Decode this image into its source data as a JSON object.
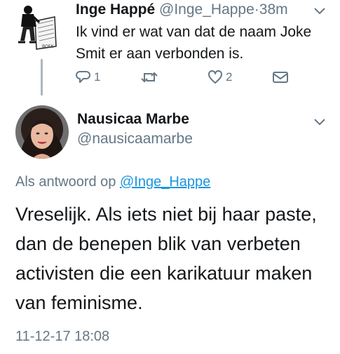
{
  "parent_tweet": {
    "author_name": "Inge Happé",
    "author_handle": "@Inge_Happe",
    "separator": "·",
    "time_ago": "38m",
    "text": "Ik vind er wat van dat de naam Joke Smit er aan verbonden is.",
    "actions": {
      "reply_count": "1",
      "retweet_count": "",
      "like_count": "2"
    }
  },
  "main_tweet": {
    "author_name": "Nausicaa Marbe",
    "author_handle": "@nausicaamarbe",
    "replying_to_prefix": "Als antwoord op",
    "replying_to_handle": "@Inge_Happe",
    "text": "Vreselijk. Als iets niet bij haar paste, dan de benepen blik van verbeten activisten die een karikatuur maken van feminisme.",
    "timestamp": "11-12-17 18:08"
  },
  "icons": {
    "reply": "reply-icon",
    "retweet": "retweet-icon",
    "like": "heart-icon",
    "dm": "envelope-icon",
    "menu": "chevron-down-icon"
  },
  "colors": {
    "text": "#14171a",
    "secondary": "#657786",
    "link": "#1b95e0"
  }
}
